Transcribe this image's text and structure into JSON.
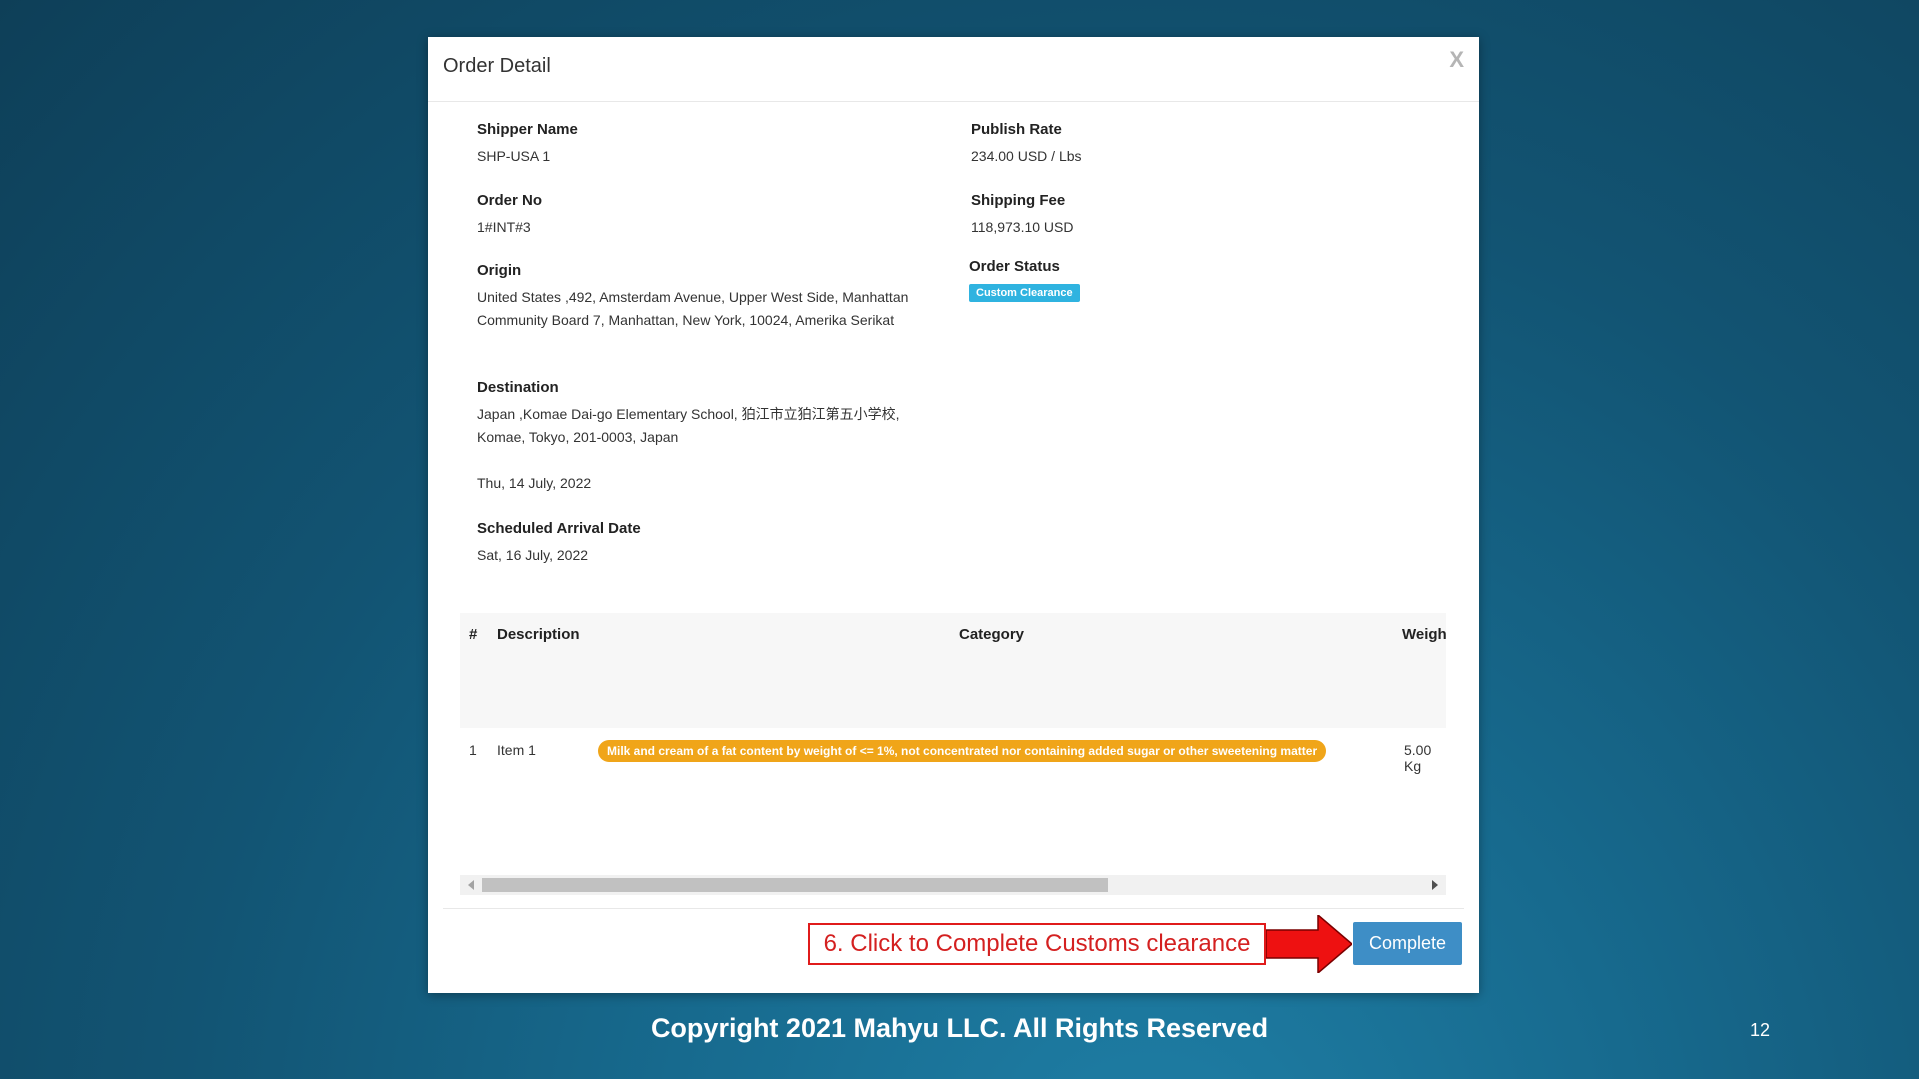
{
  "modal": {
    "title": "Order Detail",
    "close_label": "X"
  },
  "fields": {
    "shipper_name_label": "Shipper Name",
    "shipper_name_value": "SHP-USA 1",
    "order_no_label": "Order No",
    "order_no_value": "1#INT#3",
    "origin_label": "Origin",
    "origin_value": "United States ,492, Amsterdam Avenue, Upper West Side, Manhattan Community Board 7, Manhattan, New York, 10024, Amerika Serikat",
    "destination_label": "Destination",
    "destination_value": "Japan ,Komae Dai-go Elementary School, 狛江市立狛江第五小学校, Komae, Tokyo, 201-0003, Japan",
    "departure_date_value": "Thu, 14 July, 2022",
    "arrival_label": "Scheduled Arrival Date",
    "arrival_value": "Sat, 16 July, 2022",
    "publish_rate_label": "Publish Rate",
    "publish_rate_value": "234.00 USD / Lbs",
    "shipping_fee_label": "Shipping Fee",
    "shipping_fee_value": "118,973.10 USD",
    "order_status_label": "Order Status",
    "order_status_value": "Custom Clearance"
  },
  "table": {
    "headers": {
      "num": "#",
      "description": "Description",
      "category": "Category",
      "weight": "Weigh"
    },
    "rows": [
      {
        "num": "1",
        "description": "Item 1",
        "category": "Milk and cream of a fat content by weight of <= 1%, not concentrated nor containing added sugar or other sweetening matter",
        "weight": "5.00 Kg"
      }
    ]
  },
  "annotation": {
    "text": "6. Click to Complete Customs clearance"
  },
  "complete_button": "Complete",
  "footer": {
    "copyright": "Copyright 2021 Mahyu LLC. All Rights Reserved",
    "page_number": "12"
  },
  "colors": {
    "status_badge": "#2fb3e0",
    "category_badge": "#f0a519",
    "button": "#3e8ec6",
    "annotation": "#d42020"
  }
}
